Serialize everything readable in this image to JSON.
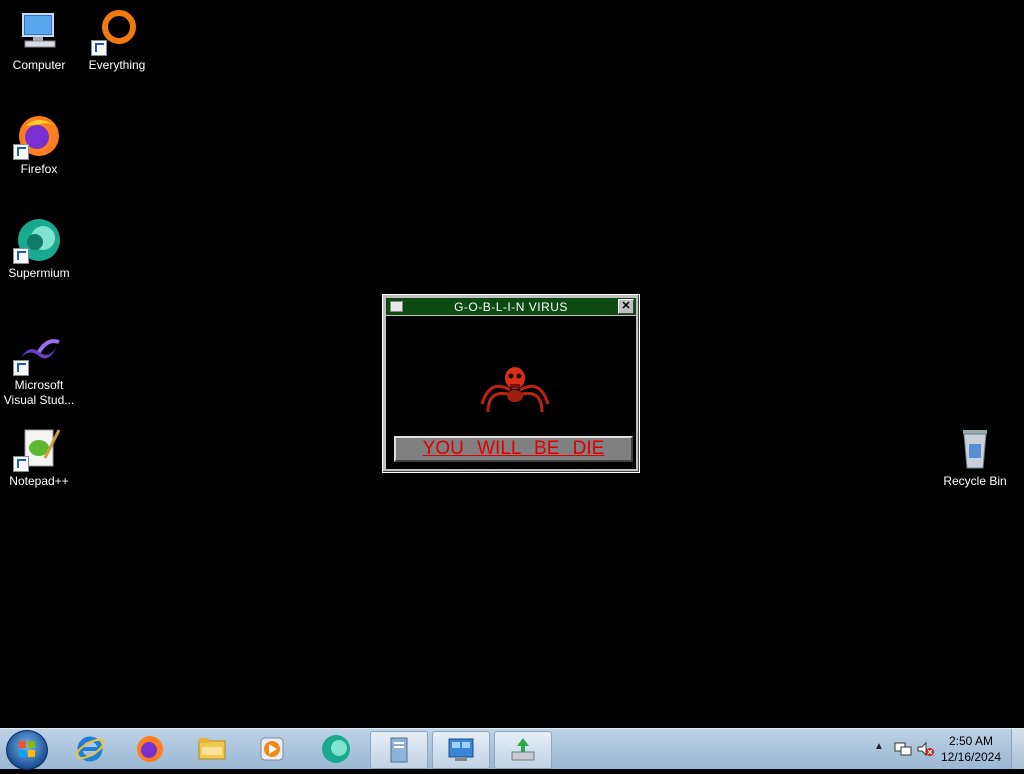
{
  "desktop": {
    "icons": [
      {
        "label": "Computer",
        "icon": "computer-icon"
      },
      {
        "label": "Everything",
        "icon": "everything-icon"
      },
      {
        "label": "Firefox",
        "icon": "firefox-icon"
      },
      {
        "label": "Supermium",
        "icon": "supermium-icon"
      },
      {
        "label": "Microsoft Visual Stud...",
        "icon": "visual-studio-icon"
      },
      {
        "label": "Notepad++",
        "icon": "notepadpp-icon"
      },
      {
        "label": "Recycle Bin",
        "icon": "recycle-bin-icon"
      }
    ]
  },
  "popup": {
    "title": "G-O-B-L-I-N VIRUS",
    "close_label": "✕",
    "message": "YOU WILL BE DIE"
  },
  "taskbar": {
    "start": "start-button",
    "pinned": [
      "internet-explorer-icon",
      "firefox-icon",
      "file-explorer-icon",
      "media-player-icon",
      "supermium-icon"
    ],
    "running": [
      "notepad-window-icon",
      "control-panel-icon",
      "installer-icon"
    ],
    "tray": {
      "icons": [
        "show-hidden-icons-arrow",
        "network-icon",
        "volume-muted-icon"
      ],
      "time": "2:50 AM",
      "date": "12/16/2024"
    }
  },
  "colors": {
    "desktop_bg": "#000000",
    "popup_title_bg": "#0c4a12",
    "banner_text": "#e00000",
    "taskbar": "#bcd2e6"
  }
}
